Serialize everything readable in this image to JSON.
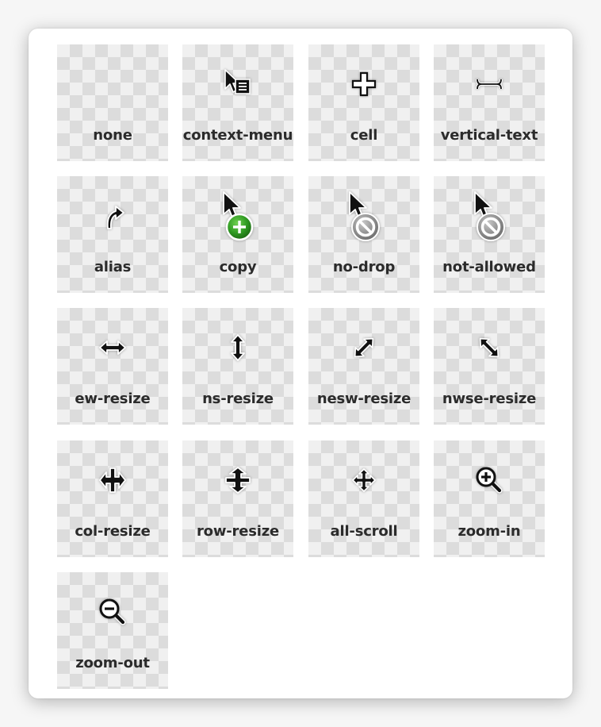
{
  "cursors": [
    {
      "label": "none",
      "icon": "none-icon"
    },
    {
      "label": "context-menu",
      "icon": "context-menu-cursor-icon"
    },
    {
      "label": "cell",
      "icon": "cell-cursor-icon"
    },
    {
      "label": "vertical-text",
      "icon": "vertical-text-cursor-icon"
    },
    {
      "label": "alias",
      "icon": "alias-cursor-icon"
    },
    {
      "label": "copy",
      "icon": "copy-cursor-icon"
    },
    {
      "label": "no-drop",
      "icon": "no-drop-cursor-icon"
    },
    {
      "label": "not-allowed",
      "icon": "not-allowed-cursor-icon"
    },
    {
      "label": "ew-resize",
      "icon": "ew-resize-cursor-icon"
    },
    {
      "label": "ns-resize",
      "icon": "ns-resize-cursor-icon"
    },
    {
      "label": "nesw-resize",
      "icon": "nesw-resize-cursor-icon"
    },
    {
      "label": "nwse-resize",
      "icon": "nwse-resize-cursor-icon"
    },
    {
      "label": "col-resize",
      "icon": "col-resize-cursor-icon"
    },
    {
      "label": "row-resize",
      "icon": "row-resize-cursor-icon"
    },
    {
      "label": "all-scroll",
      "icon": "all-scroll-cursor-icon"
    },
    {
      "label": "zoom-in",
      "icon": "zoom-in-cursor-icon"
    },
    {
      "label": "zoom-out",
      "icon": "zoom-out-cursor-icon"
    }
  ],
  "colors": {
    "tile_light": "#f0f0f0",
    "tile_dark": "#dcdcdc",
    "label_text": "#2b2b2b",
    "copy_badge_green": "#3a9a2a"
  }
}
